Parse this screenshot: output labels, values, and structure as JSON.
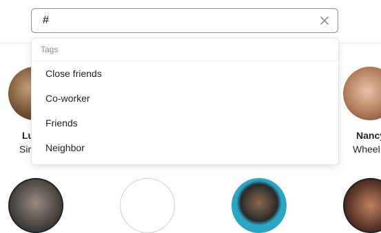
{
  "search": {
    "value": "#",
    "placeholder": ""
  },
  "dropdown": {
    "header": "Tags",
    "items": [
      {
        "label": "Close friends"
      },
      {
        "label": "Co-worker"
      },
      {
        "label": "Friends"
      },
      {
        "label": "Neighbor"
      }
    ]
  },
  "contacts": [
    {
      "first_name": "Lu",
      "last_name": "Sir"
    },
    {
      "first_name": "Nancy",
      "last_name": "Wheel"
    }
  ],
  "icons": {
    "clear": "close-icon"
  },
  "colors": {
    "border": "#8a8f98",
    "muted_text": "#8a8a8a",
    "teal_avatar": "#2aa6c4"
  }
}
